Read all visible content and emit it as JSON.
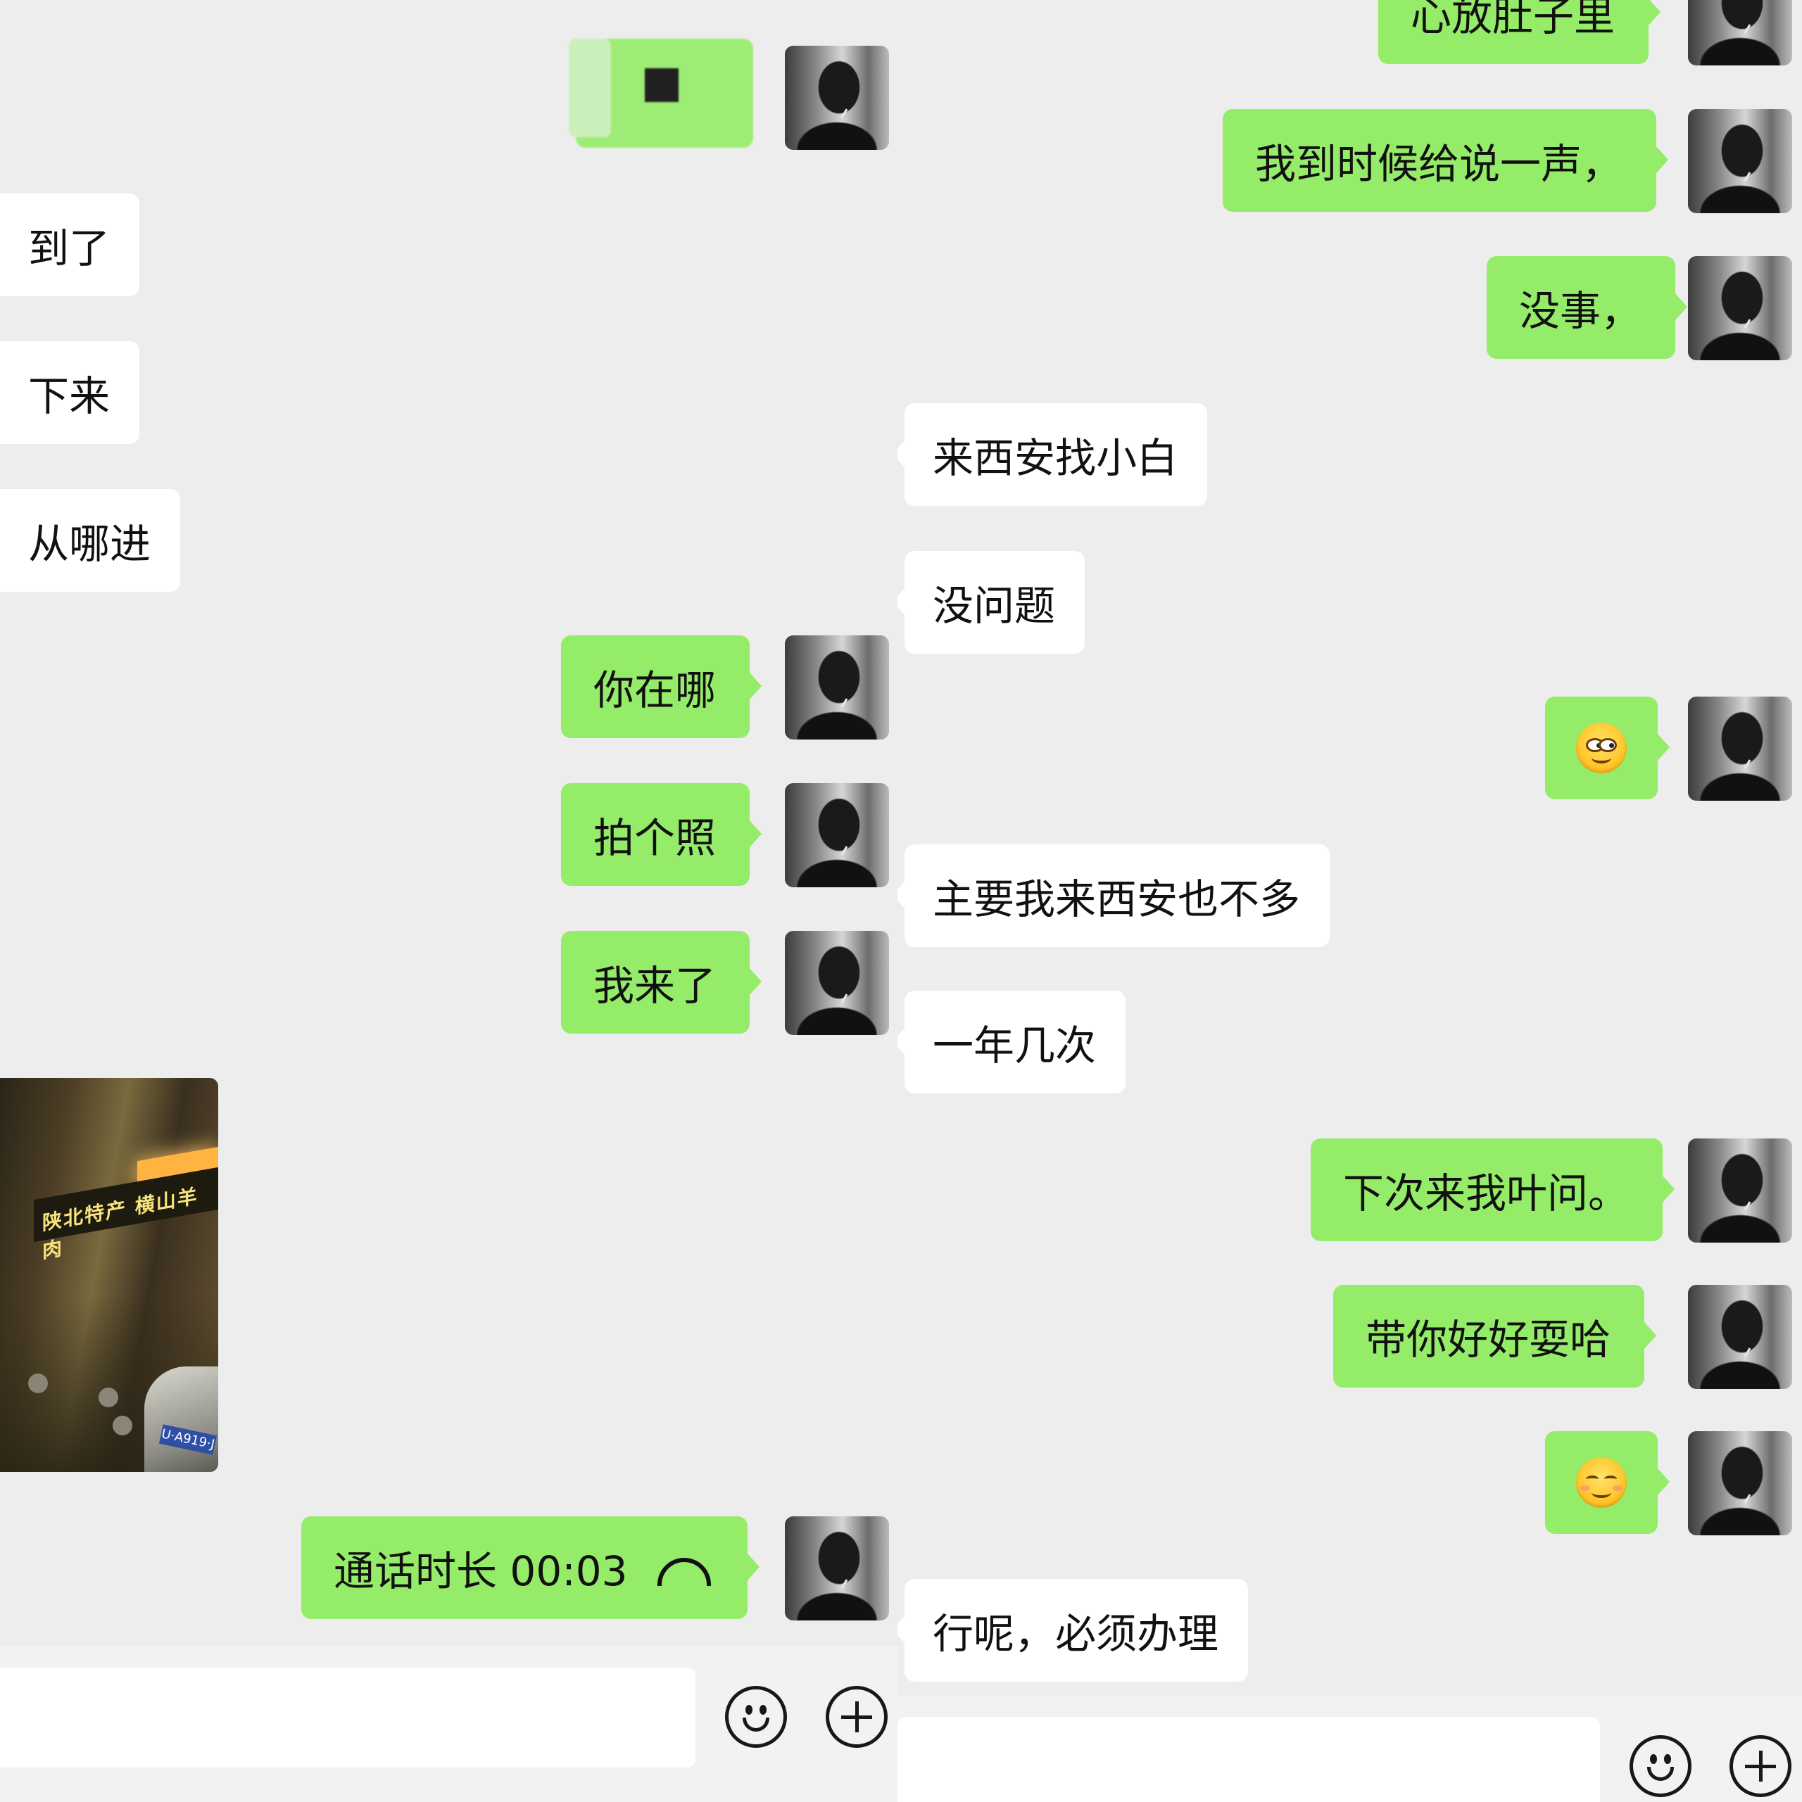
{
  "left_chat": {
    "messages": [
      {
        "side": "me",
        "type": "redacted"
      },
      {
        "side": "other",
        "text": "到了"
      },
      {
        "side": "other",
        "text": "下来"
      },
      {
        "side": "other",
        "text": "从哪进"
      },
      {
        "side": "me",
        "text": "你在哪"
      },
      {
        "side": "me",
        "text": "拍个照"
      },
      {
        "side": "me",
        "text": "我来了"
      },
      {
        "side": "other",
        "type": "image",
        "text": "陕北特产 横山羊肉",
        "plate": "U·A919·J"
      },
      {
        "side": "me",
        "type": "call",
        "text": "通话时长 00:03",
        "icon": "hangup-phone-icon"
      }
    ],
    "input": {
      "placeholder": "",
      "emoji_icon": "smile-icon",
      "more_icon": "plus-icon"
    }
  },
  "right_chat": {
    "messages": [
      {
        "side": "me",
        "text": "心放肚子里"
      },
      {
        "side": "me",
        "text": "我到时候给说一声，"
      },
      {
        "side": "me",
        "text": "没事，"
      },
      {
        "side": "other",
        "text": "来西安找小白"
      },
      {
        "side": "other",
        "text": "没问题"
      },
      {
        "side": "me",
        "type": "emoji",
        "icon": "sly-smile-emoji"
      },
      {
        "side": "other",
        "text": "主要我来西安也不多"
      },
      {
        "side": "other",
        "text": "一年几次"
      },
      {
        "side": "me",
        "text": "下次来我叶问。"
      },
      {
        "side": "me",
        "text": "带你好好耍哈"
      },
      {
        "side": "me",
        "type": "emoji",
        "icon": "blush-smile-emoji"
      },
      {
        "side": "other",
        "text": "行呢，必须办理"
      }
    ],
    "input": {
      "placeholder": "",
      "emoji_icon": "smile-icon",
      "more_icon": "plus-icon"
    }
  },
  "colors": {
    "background": "#ededed",
    "my_bubble": "#95ec69",
    "other_bubble": "#ffffff"
  }
}
